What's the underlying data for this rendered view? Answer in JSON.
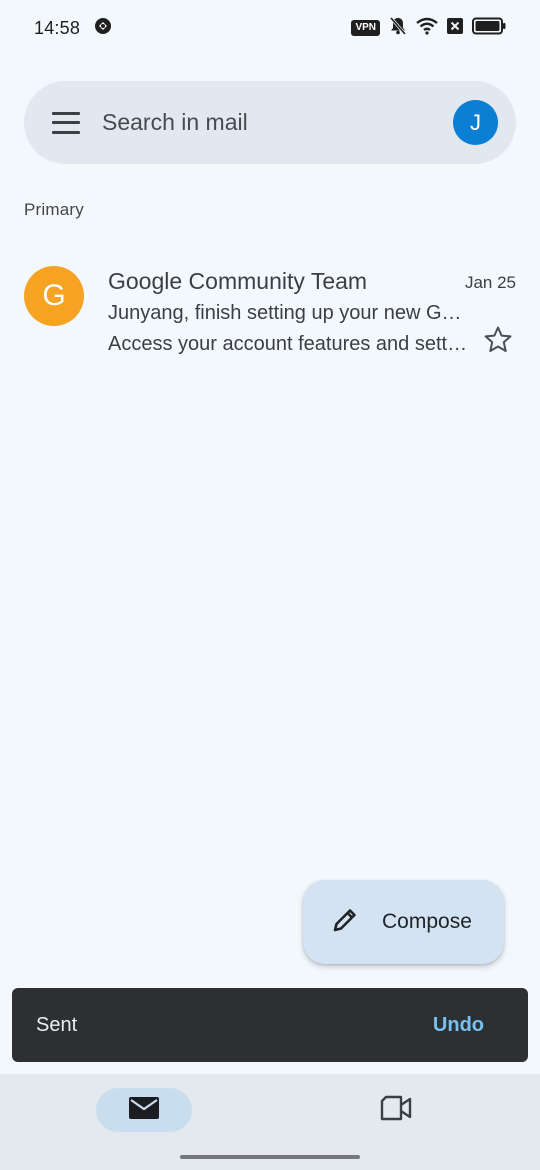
{
  "status_bar": {
    "time": "14:58",
    "vpn_label": "VPN",
    "icons": [
      "vpn-icon",
      "bell-off-icon",
      "wifi-icon",
      "sim-off-icon",
      "battery-icon"
    ]
  },
  "search": {
    "placeholder": "Search in mail",
    "avatar_initial": "J",
    "avatar_color": "#0b7fd4"
  },
  "section": {
    "label": "Primary"
  },
  "mail_list": [
    {
      "avatar_initial": "G",
      "avatar_color": "#f6a323",
      "sender": "Google Community Team",
      "date": "Jan 25",
      "subject": "Junyang, finish setting up your new Google Account",
      "snippet": "Access your account features and settings",
      "starred": false
    }
  ],
  "compose": {
    "label": "Compose"
  },
  "snackbar": {
    "message": "Sent",
    "action": "Undo",
    "action_color": "#79c0f0"
  },
  "bottom_nav": {
    "items": [
      {
        "name": "mail",
        "icon": "mail-icon",
        "selected": true
      },
      {
        "name": "meet",
        "icon": "video-camera-icon",
        "selected": false
      }
    ]
  }
}
